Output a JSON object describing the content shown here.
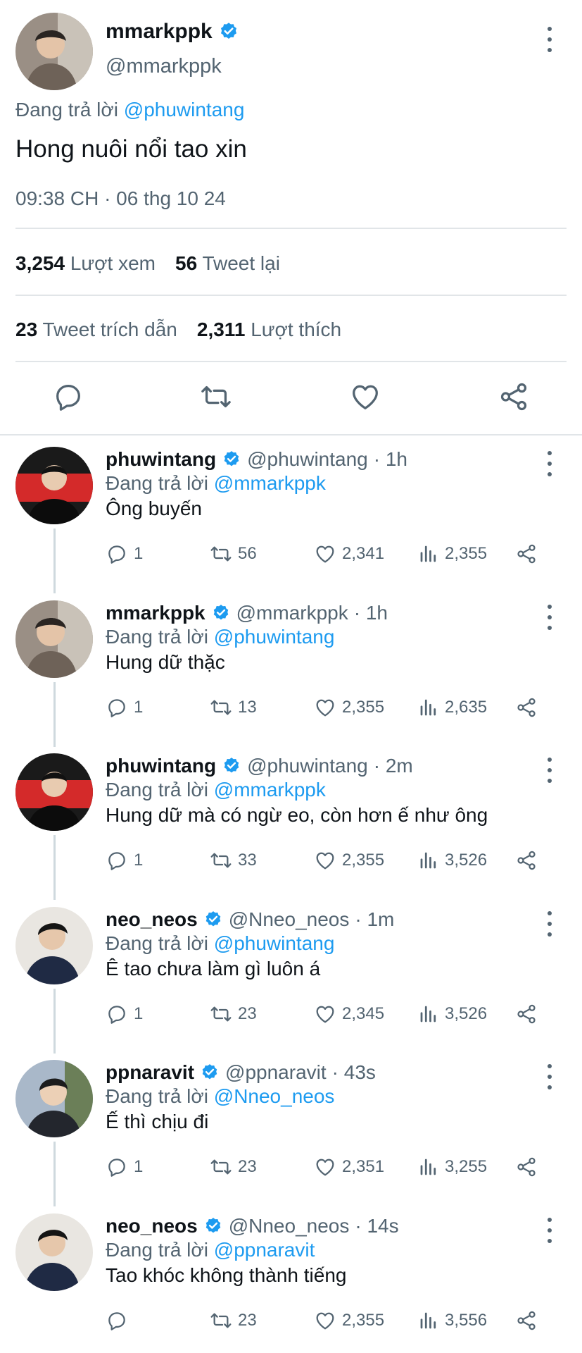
{
  "colors": {
    "accent": "#1d9bf0",
    "muted": "#536471",
    "text": "#0f1419",
    "divider": "#e1e5e8"
  },
  "main": {
    "name": "mmarkppk",
    "handle": "@mmarkppk",
    "reply_prefix": "Đang trả lời",
    "reply_to": "@phuwintang",
    "text": "Hong nuôi nổi tao xin",
    "timestamp": "09:38 CH · 06 thg 10 24",
    "stats": {
      "views_count": "3,254",
      "views_label": "Lượt xem",
      "retweets_count": "56",
      "retweets_label": "Tweet lại",
      "quotes_count": "23",
      "quotes_label": "Tweet trích dẫn",
      "likes_count": "2,311",
      "likes_label": "Lượt thích"
    },
    "actions": [
      "reply-icon",
      "retweet-icon",
      "like-icon",
      "share-icon"
    ]
  },
  "replies": [
    {
      "name": "phuwintang",
      "handle": "@phuwintang",
      "time": "· 1h",
      "reply_prefix": "Đang trả lời",
      "reply_to": "@mmarkppk",
      "text": "Ông buyến",
      "replies": "1",
      "retweets": "56",
      "likes": "2,341",
      "views": "2,355"
    },
    {
      "name": "mmarkppk",
      "handle": "@mmarkppk",
      "time": "· 1h",
      "reply_prefix": "Đang trả lời",
      "reply_to": "@phuwintang",
      "text": "Hung dữ thặc",
      "replies": "1",
      "retweets": "13",
      "likes": "2,355",
      "views": "2,635"
    },
    {
      "name": "phuwintang",
      "handle": "@phuwintang",
      "time": "· 2m",
      "reply_prefix": "Đang trả lời",
      "reply_to": "@mmarkppk",
      "text": "Hung dữ mà có ngừ eo, còn hơn ế như ông",
      "replies": "1",
      "retweets": "33",
      "likes": "2,355",
      "views": "3,526"
    },
    {
      "name": "neo_neos",
      "handle": "@Nneo_neos",
      "time": "· 1m",
      "reply_prefix": "Đang trả lời",
      "reply_to": "@phuwintang",
      "text": "Ê tao chưa làm gì luôn á",
      "replies": "1",
      "retweets": "23",
      "likes": "2,345",
      "views": "3,526"
    },
    {
      "name": "ppnaravit",
      "handle": "@ppnaravit",
      "time": "· 43s",
      "reply_prefix": "Đang trả lời",
      "reply_to": "@Nneo_neos",
      "text": "Ế thì chịu đi",
      "replies": "1",
      "retweets": "23",
      "likes": "2,351",
      "views": "3,255"
    },
    {
      "name": "neo_neos",
      "handle": "@Nneo_neos",
      "time": "· 14s",
      "reply_prefix": "Đang trả lời",
      "reply_to": "@ppnaravit",
      "text": "Tao khóc không thành tiếng",
      "replies": "",
      "retweets": "23",
      "likes": "2,355",
      "views": "3,556"
    }
  ]
}
